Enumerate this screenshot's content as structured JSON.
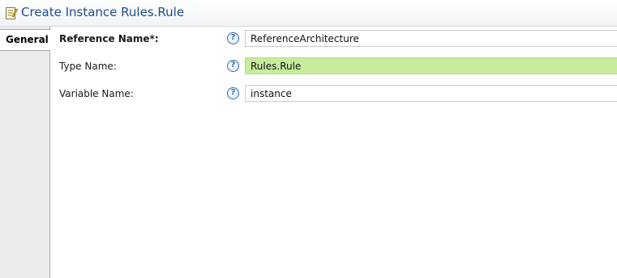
{
  "window": {
    "title": "Create Instance Rules.Rule",
    "title_icon": "edit-properties-icon"
  },
  "tabs": [
    {
      "label": "General",
      "selected": true
    }
  ],
  "form": {
    "fields": [
      {
        "label": "Reference Name*:",
        "value": "ReferenceArchitecture",
        "required": true
      },
      {
        "label": "Type Name:",
        "value": "Rules.Rule",
        "highlight": "#c6ec9c"
      },
      {
        "label": "Variable Name:",
        "value": "instance"
      }
    ],
    "help_glyph": "?"
  },
  "colors": {
    "title": "#1f4e8c",
    "help_icon": "#2f6db5",
    "type_field_bg": "#c6ec9c"
  }
}
